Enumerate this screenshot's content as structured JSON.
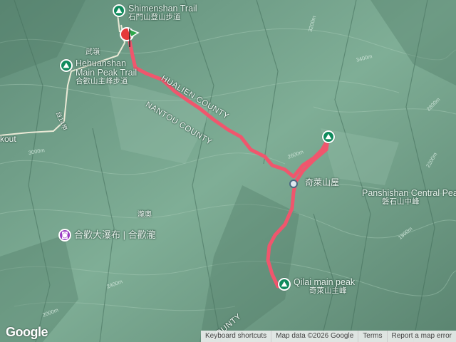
{
  "map": {
    "pois": [
      {
        "id": "shimenshan",
        "name_en": "Shimenshan Trail",
        "name_zh": "石門山登山步道",
        "icon": "hiking-icon"
      },
      {
        "id": "hehuan",
        "name_en": "Hehuanshan Main Peak Trail",
        "name_zh": "合歡山主峰步道",
        "icon": "hiking-icon"
      },
      {
        "id": "panshishan",
        "name_en": "Panshishan Central Peak",
        "name_zh": "磐石山中峰",
        "icon": "hiking-icon"
      },
      {
        "id": "qilai",
        "name_en": "Qilai main peak",
        "name_zh": "奇萊山主峰",
        "icon": "hiking-icon"
      },
      {
        "id": "falls",
        "name_en": "",
        "name_zh": "合歡大瀑布 | 合歡瀧",
        "icon": "camera-icon"
      }
    ],
    "labels": {
      "wuling": "武嶺",
      "hualien_county": "HUALIEN COUNTY",
      "nantou_county": "NANTOU COUNTY",
      "county_bottom": "COUNTY",
      "cabin": "奇萊山屋",
      "lookout": "kout",
      "road": "台14甲",
      "ravine": "瀧奧"
    },
    "elevations": [
      "3200m",
      "3000m",
      "2800m",
      "2600m",
      "2400m",
      "2200m",
      "2000m",
      "1800m",
      "3400m"
    ],
    "route_color": "#f0566d"
  },
  "footer": {
    "logo": "Google",
    "keyboard_shortcuts": "Keyboard shortcuts",
    "map_data": "Map data ©2026 Google",
    "terms": "Terms",
    "report": "Report a map error"
  }
}
